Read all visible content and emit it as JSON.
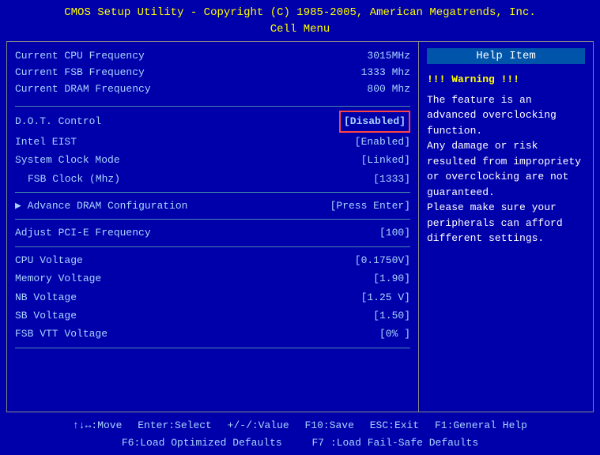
{
  "title_line1": "CMOS Setup Utility - Copyright (C) 1985-2005, American Megatrends, Inc.",
  "title_line2": "Cell Menu",
  "info_items": [
    {
      "label": "Current CPU Frequency",
      "value": "3015MHz"
    },
    {
      "label": "Current FSB Frequency",
      "value": "1333 Mhz"
    },
    {
      "label": "Current DRAM Frequency",
      "value": "800 Mhz"
    }
  ],
  "settings": [
    {
      "label": "D.O.T. Control",
      "value": "[Disabled]",
      "type": "disabled",
      "id": "dot-control"
    },
    {
      "label": "Intel EIST",
      "value": "[Enabled]",
      "type": "normal",
      "id": "intel-eist"
    },
    {
      "label": "System Clock Mode",
      "value": "[Linked]",
      "type": "normal",
      "id": "sys-clock-mode"
    },
    {
      "label": "FSB Clock (Mhz)",
      "value": "[1333]",
      "type": "sub",
      "id": "fsb-clock"
    },
    {
      "label": "Advance DRAM Configuration",
      "value": "[Press Enter]",
      "type": "arrow",
      "id": "dram-config"
    },
    {
      "label": "Adjust PCI-E Frequency",
      "value": "[100]",
      "type": "normal",
      "id": "pcie-freq"
    },
    {
      "label": "CPU Voltage",
      "value": "[0.1750V]",
      "type": "normal",
      "id": "cpu-voltage"
    },
    {
      "label": "Memory Voltage",
      "value": "[1.90]",
      "type": "normal",
      "id": "mem-voltage"
    },
    {
      "label": "NB Voltage",
      "value": "[1.25 V]",
      "type": "normal",
      "id": "nb-voltage"
    },
    {
      "label": "SB Voltage",
      "value": "[1.50]",
      "type": "normal",
      "id": "sb-voltage"
    },
    {
      "label": "FSB VTT Voltage",
      "value": "[0%  ]",
      "type": "normal",
      "id": "fsb-vtt-voltage"
    }
  ],
  "help": {
    "title": "Help Item",
    "warning": "!!! Warning !!!",
    "text": "The feature is an advanced overclocking function.\nAny damage or risk resulted from impropriety or overclocking are not guaranteed.\nPlease make sure your peripherals can afford different settings."
  },
  "footer": {
    "line1_items": [
      {
        "key": "↑↓↔",
        "action": "Move"
      },
      {
        "key": "Enter",
        "action": "Select"
      },
      {
        "key": "+/-/:",
        "action": "Value"
      },
      {
        "key": "F10",
        "action": "Save"
      },
      {
        "key": "ESC",
        "action": "Exit"
      },
      {
        "key": "F1",
        "action": "General Help"
      }
    ],
    "line2_items": [
      {
        "key": "F6",
        "action": "Load Optimized Defaults"
      },
      {
        "key": "F7",
        "action": "Load Fail-Safe Defaults"
      }
    ]
  }
}
